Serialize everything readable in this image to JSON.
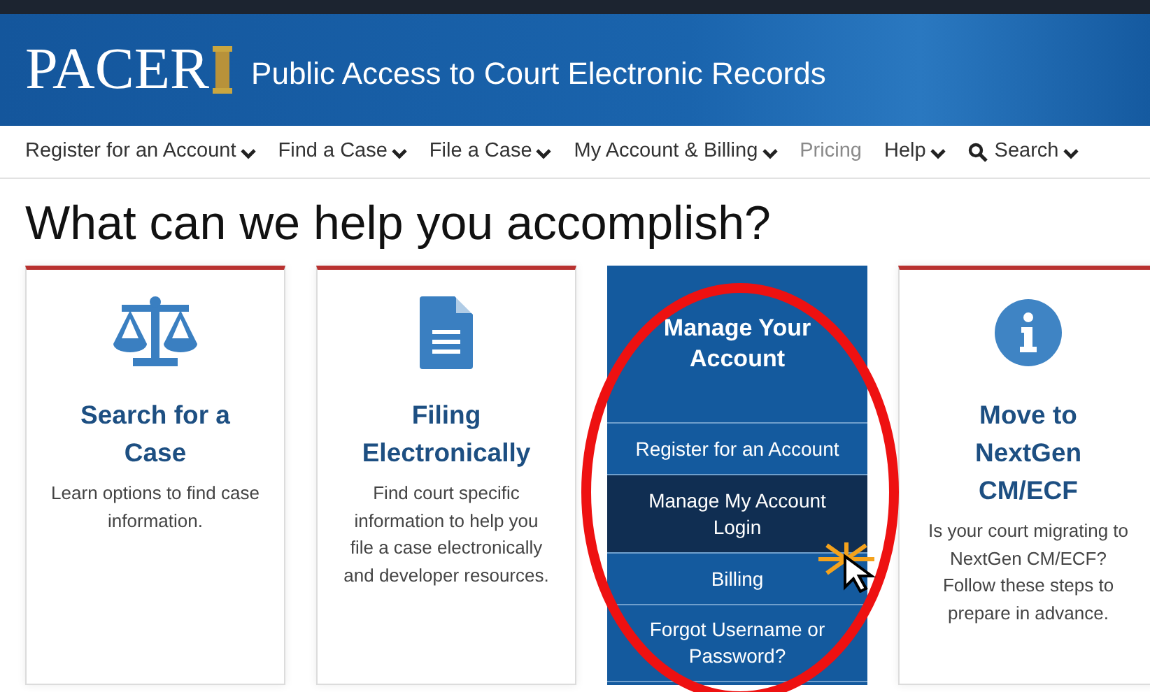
{
  "header": {
    "logo": "PACER",
    "tagline": "Public Access to Court Electronic Records"
  },
  "nav": [
    {
      "label": "Register for an Account",
      "kind": "dropdown"
    },
    {
      "label": "Find a Case",
      "kind": "dropdown"
    },
    {
      "label": "File a Case",
      "kind": "dropdown"
    },
    {
      "label": "My Account & Billing",
      "kind": "dropdown"
    },
    {
      "label": "Pricing",
      "kind": "link"
    },
    {
      "label": "Help",
      "kind": "dropdown"
    },
    {
      "label": "Search",
      "kind": "search"
    }
  ],
  "heading": "What can we help you accomplish?",
  "cards": [
    {
      "kind": "info",
      "title": "Search for a Case",
      "text": "Learn options to find case information."
    },
    {
      "kind": "info",
      "title": "Filing Electronically",
      "text": "Find court specific information to help you file a case electronically and developer resources."
    },
    {
      "kind": "menu",
      "title": "Manage Your Account",
      "items": [
        {
          "label": "Register for an Account",
          "selected": false
        },
        {
          "label": "Manage My Account Login",
          "selected": true
        },
        {
          "label": "Billing",
          "selected": false
        },
        {
          "label": "Forgot Username or Password?",
          "selected": false
        }
      ]
    },
    {
      "kind": "info",
      "title": "Move to NextGen CM/ECF",
      "text": "Is your court migrating to NextGen CM/ECF? Follow these steps to prepare in advance."
    }
  ]
}
